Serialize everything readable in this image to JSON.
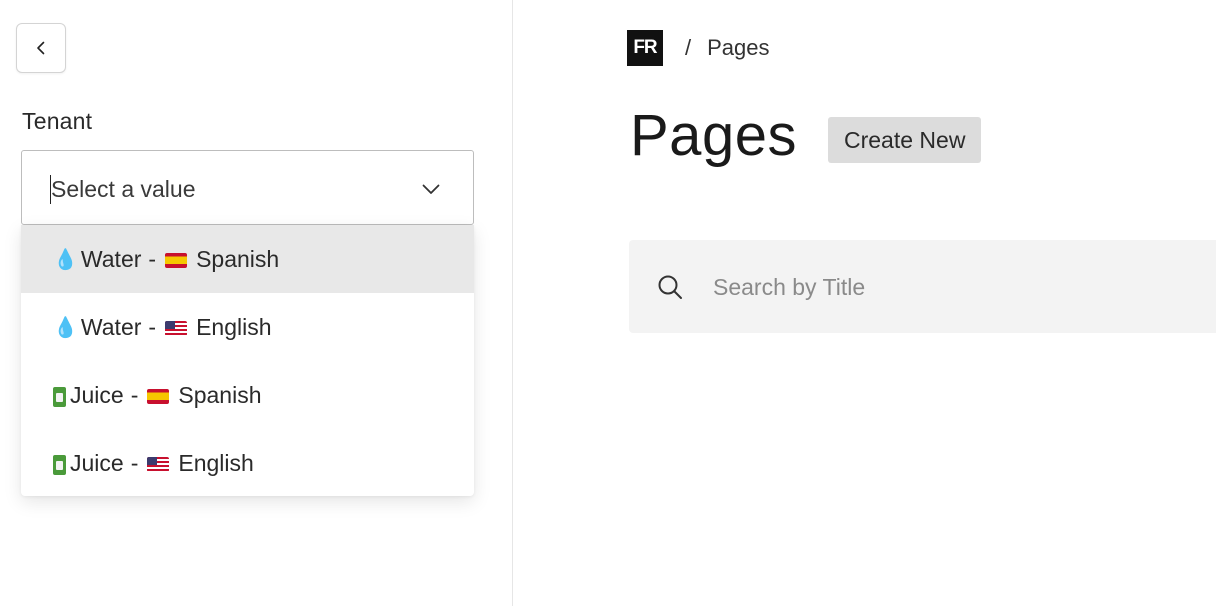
{
  "sidebar": {
    "tenant_label": "Tenant",
    "select": {
      "value": "Select a value",
      "options": [
        {
          "product": "Water",
          "separator": "-",
          "language": "Spanish",
          "product_icon": "water-drop-icon",
          "flag_icon": "spain-flag-icon"
        },
        {
          "product": "Water",
          "separator": "-",
          "language": "English",
          "product_icon": "water-drop-icon",
          "flag_icon": "us-flag-icon"
        },
        {
          "product": "Juice",
          "separator": "-",
          "language": "Spanish",
          "product_icon": "juice-box-icon",
          "flag_icon": "spain-flag-icon"
        },
        {
          "product": "Juice",
          "separator": "-",
          "language": "English",
          "product_icon": "juice-box-icon",
          "flag_icon": "us-flag-icon"
        }
      ]
    }
  },
  "main": {
    "breadcrumb": {
      "logo_text": "FR",
      "separator": "/",
      "current": "Pages"
    },
    "title": "Pages",
    "create_label": "Create New",
    "search": {
      "placeholder": "Search by Title",
      "value": ""
    }
  },
  "colors": {
    "active_option_bg": "#e8e8e8",
    "create_button_bg": "#dcdcdc",
    "search_bg": "#f3f3f3",
    "logo_bg": "#111111"
  }
}
